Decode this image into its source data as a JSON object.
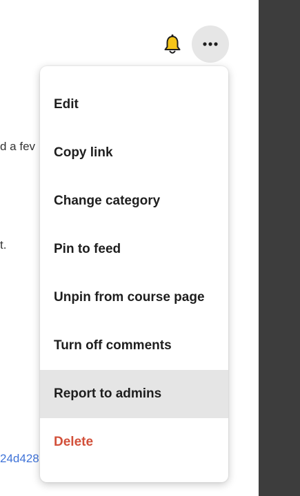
{
  "background": {
    "fragments": [
      "d a fev",
      "t.",
      "24d428"
    ]
  },
  "header": {
    "notifications_icon": "bell-icon",
    "more_icon": "more-horizontal-icon"
  },
  "menu": {
    "items": [
      {
        "label": "Edit"
      },
      {
        "label": "Copy link"
      },
      {
        "label": "Change category"
      },
      {
        "label": "Pin to feed"
      },
      {
        "label": "Unpin from course page"
      },
      {
        "label": "Turn off comments"
      },
      {
        "label": "Report to admins",
        "highlighted": true
      },
      {
        "label": "Delete",
        "danger": true
      }
    ]
  },
  "colors": {
    "danger": "#d2503a",
    "link": "#3f73d8",
    "bell": "#f5c518",
    "side_panel": "#3d3d3d"
  }
}
